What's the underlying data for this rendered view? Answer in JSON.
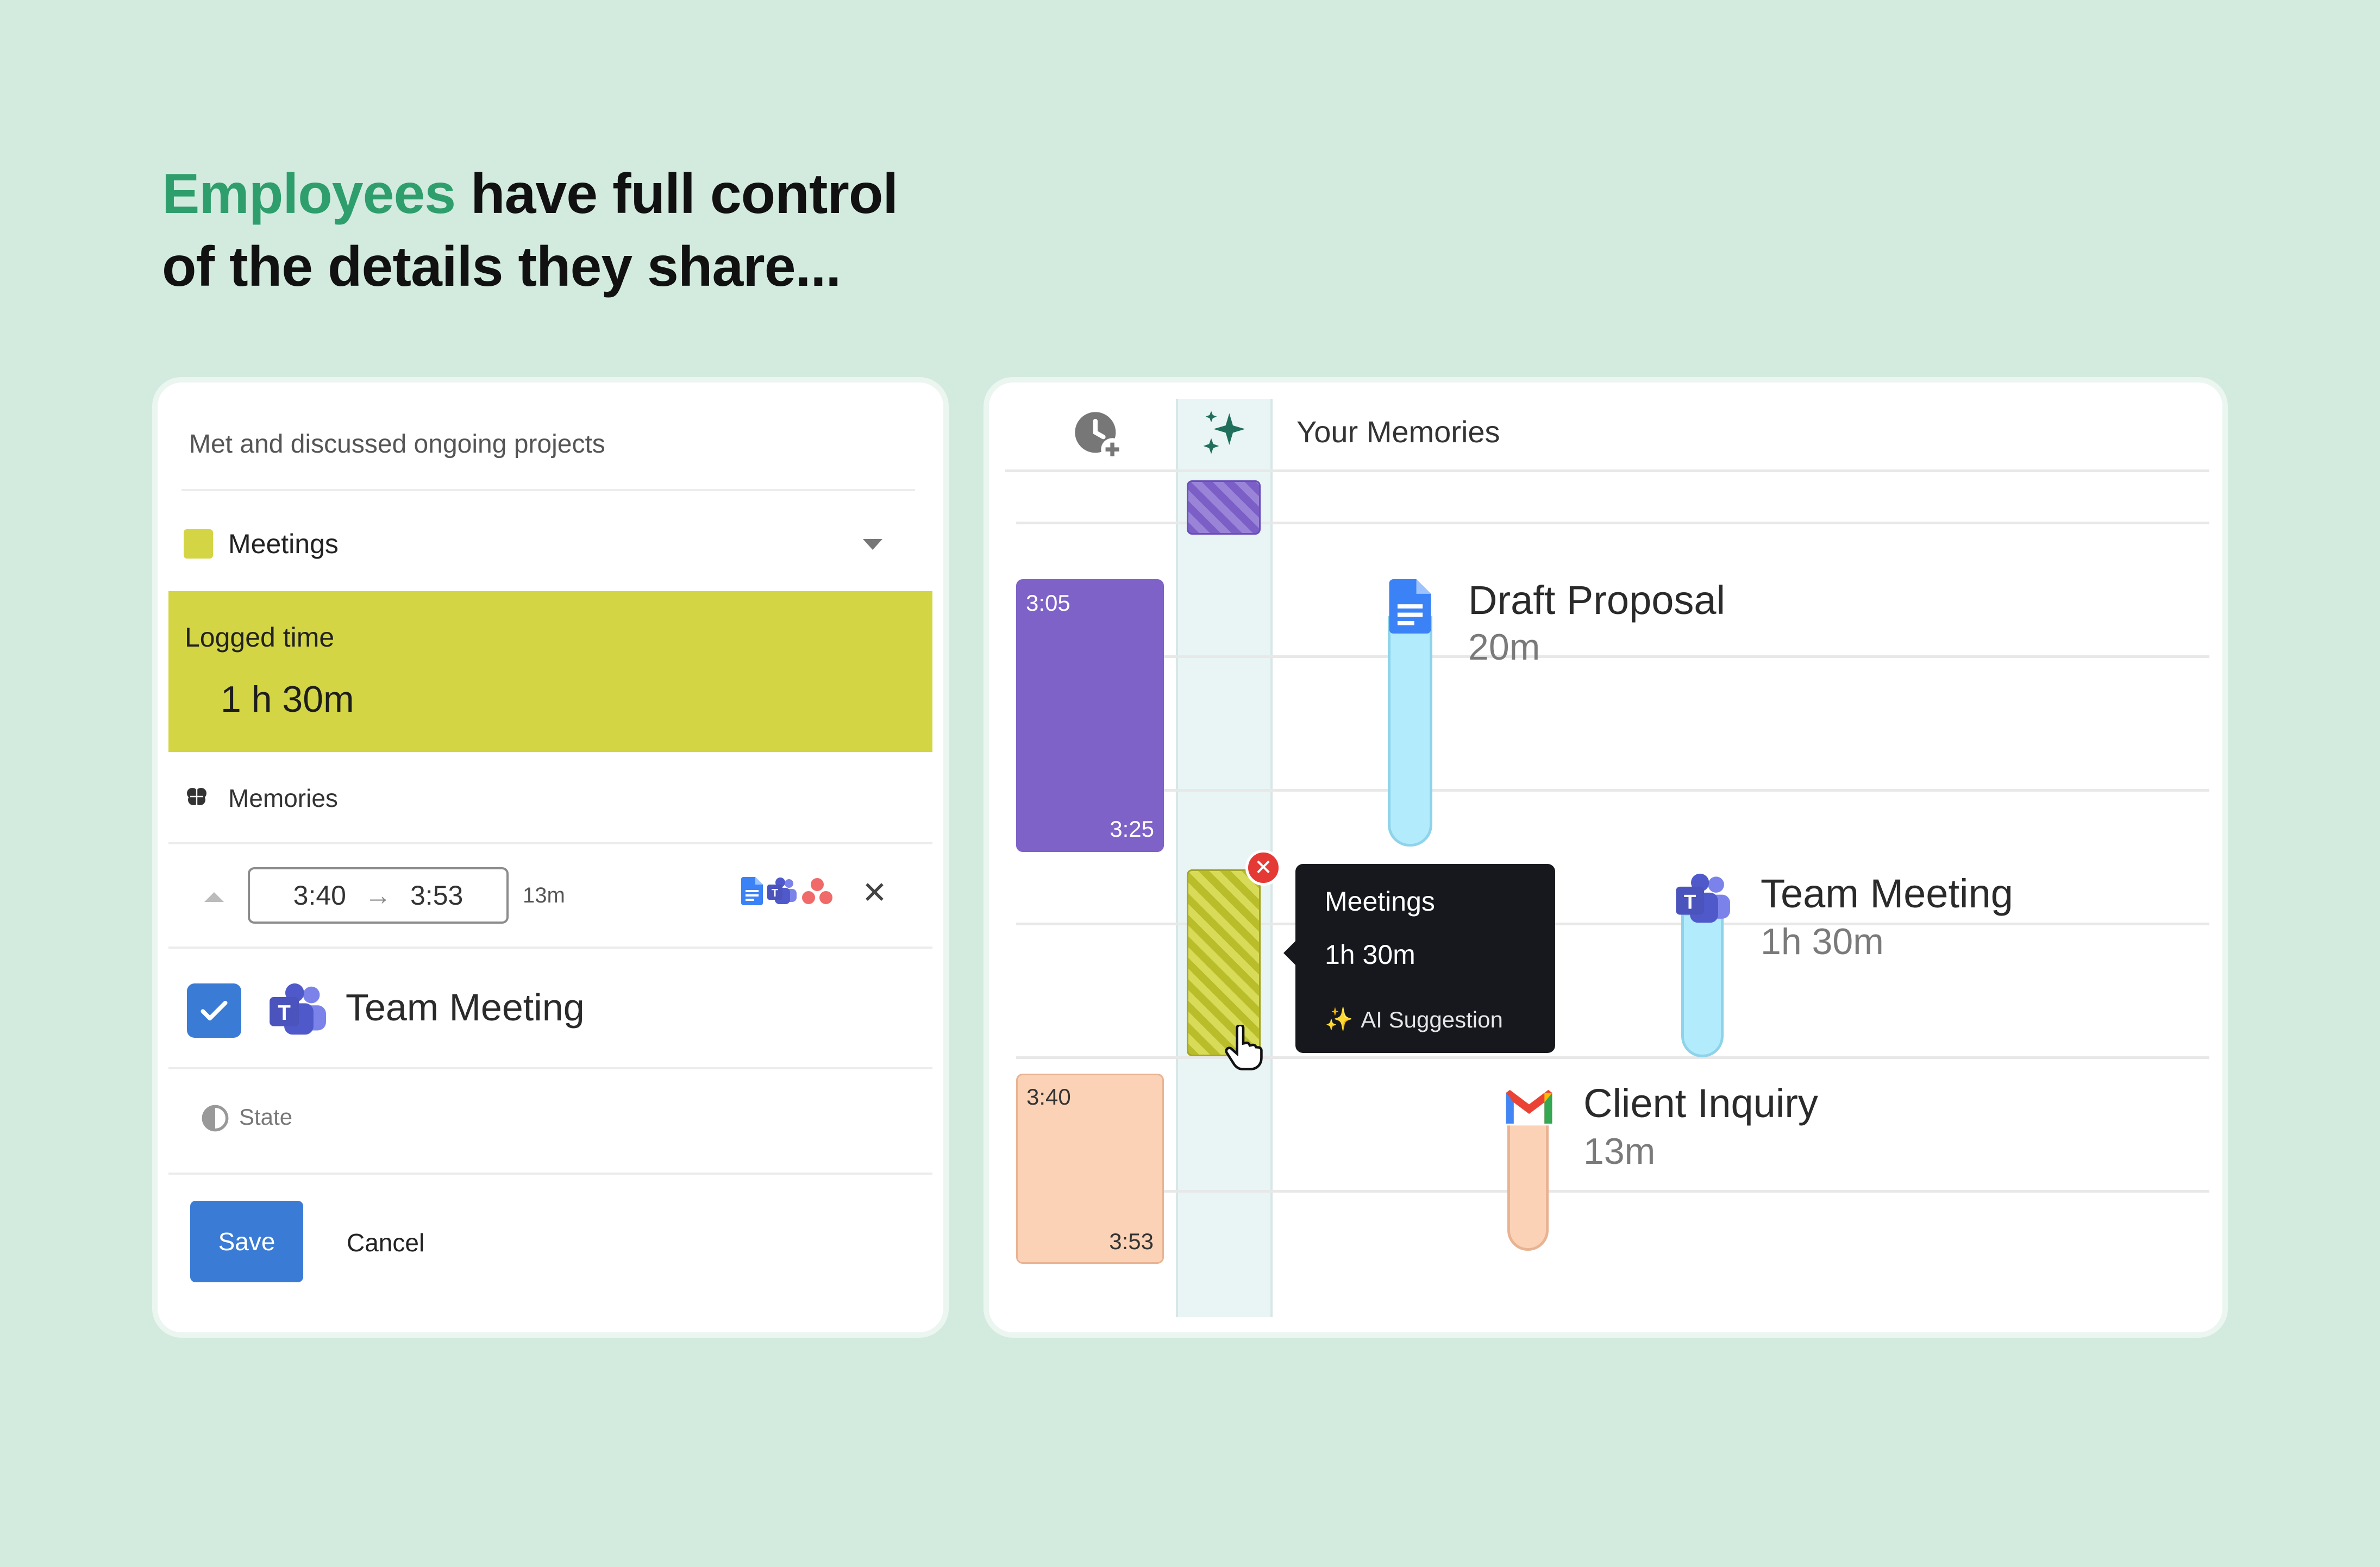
{
  "headline": {
    "accent": "Employees",
    "rest_line1": " have full control",
    "line2": "of the details they share..."
  },
  "form": {
    "description": "Met and discussed ongoing projects",
    "category": {
      "label": "Meetings",
      "color": "#d4d545"
    },
    "logged_time": {
      "label": "Logged time",
      "value": "1 h 30m"
    },
    "memories_label": "Memories",
    "memory_entry": {
      "start": "3:40",
      "end": "3:53",
      "duration": "13m",
      "apps": [
        "google-docs-icon",
        "teams-icon",
        "asana-icon"
      ]
    },
    "selected_item": {
      "checked": true,
      "label": "Team Meeting"
    },
    "state_label": "State",
    "save_label": "Save",
    "cancel_label": "Cancel"
  },
  "timeline": {
    "title": "Your Memories",
    "blocks": [
      {
        "start": "3:05",
        "end": "3:25",
        "color": "#7e62c8"
      },
      {
        "start": "3:40",
        "end": "3:53",
        "color": "#fcd2b7"
      }
    ],
    "suggestion": {
      "title": "Meetings",
      "duration": "1h 30m",
      "tag": "AI Suggestion"
    },
    "memories": [
      {
        "title": "Draft Proposal",
        "duration": "20m",
        "app": "google-docs-icon"
      },
      {
        "title": "Team Meeting",
        "duration": "1h 30m",
        "app": "teams-icon"
      },
      {
        "title": "Client Inquiry",
        "duration": "13m",
        "app": "gmail-icon"
      }
    ]
  },
  "colors": {
    "accent": "#2e9e6c",
    "background": "#d3ebdf",
    "primary": "#3a7bd5"
  }
}
